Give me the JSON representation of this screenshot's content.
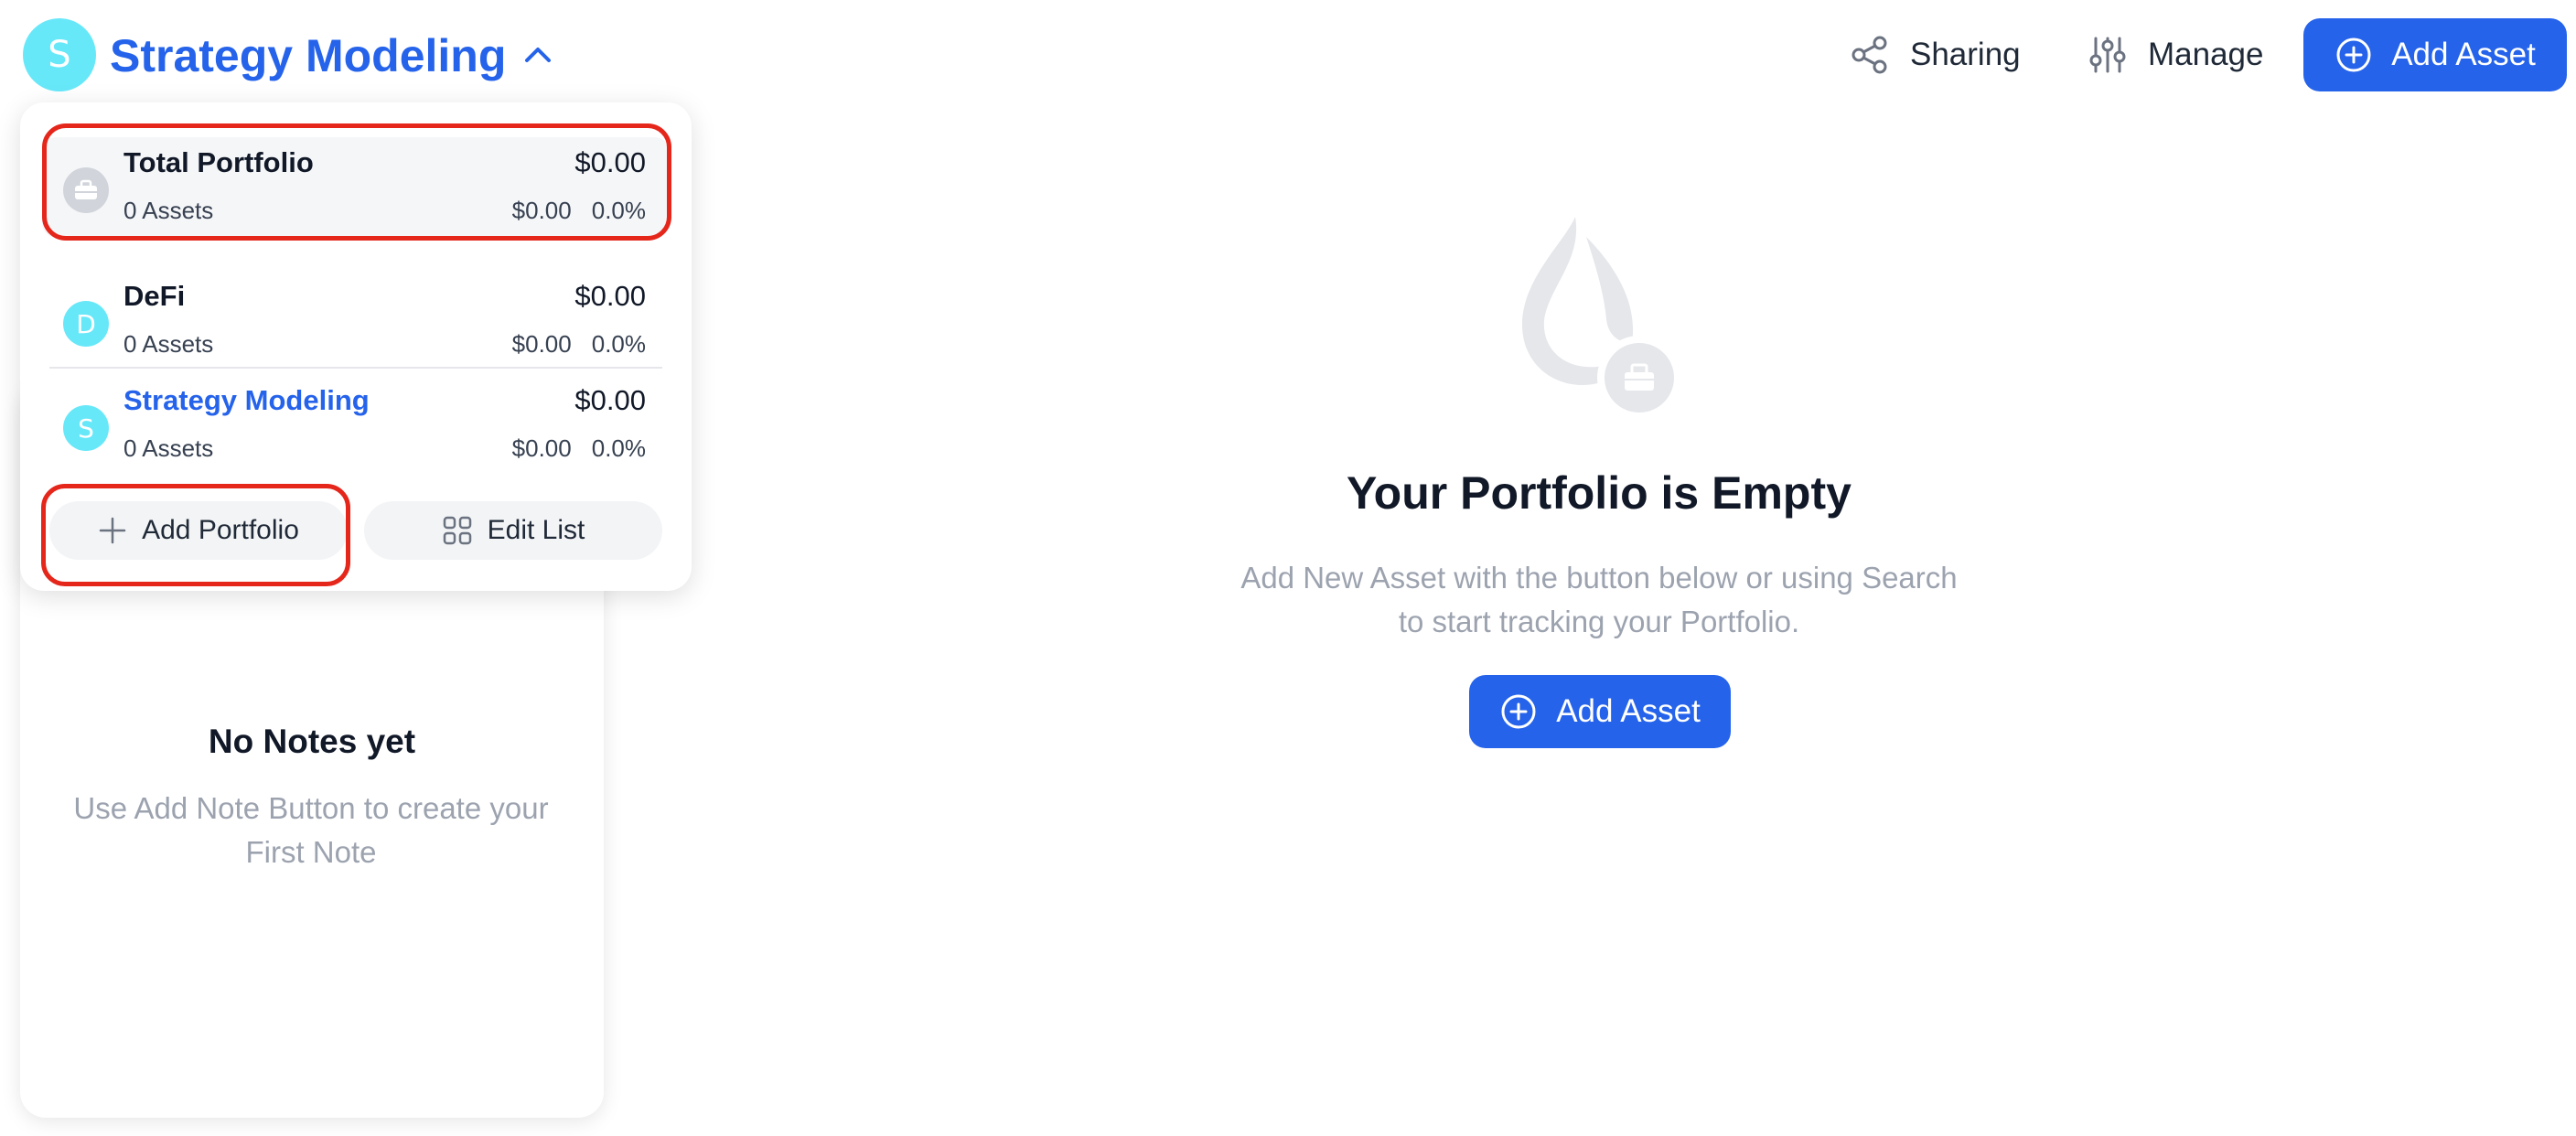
{
  "header": {
    "avatar_letter": "S",
    "portfolio_title": "Strategy Modeling",
    "sharing_label": "Sharing",
    "manage_label": "Manage",
    "add_asset_label": "Add Asset"
  },
  "dropdown": {
    "portfolios": [
      {
        "name": "Total Portfolio",
        "value": "$0.00",
        "assets": "0 Assets",
        "change_value": "$0.00",
        "change_pct": "0.0%",
        "icon": "briefcase-icon"
      },
      {
        "name": "DeFi",
        "avatar_letter": "D",
        "value": "$0.00",
        "assets": "0 Assets",
        "change_value": "$0.00",
        "change_pct": "0.0%"
      },
      {
        "name": "Strategy Modeling",
        "avatar_letter": "S",
        "value": "$0.00",
        "assets": "0 Assets",
        "change_value": "$0.00",
        "change_pct": "0.0%",
        "selected": true
      }
    ],
    "add_portfolio_label": "Add Portfolio",
    "edit_list_label": "Edit List"
  },
  "notes": {
    "title": "No Notes yet",
    "description": "Use Add Note Button to create your First Note"
  },
  "empty_state": {
    "title": "Your Portfolio is Empty",
    "description": "Add New Asset with the button below or using Search to start tracking your Portfolio.",
    "add_asset_label": "Add Asset"
  },
  "colors": {
    "accent": "#2563eb",
    "avatar": "#67e8f9",
    "annotation": "#e5261b"
  }
}
